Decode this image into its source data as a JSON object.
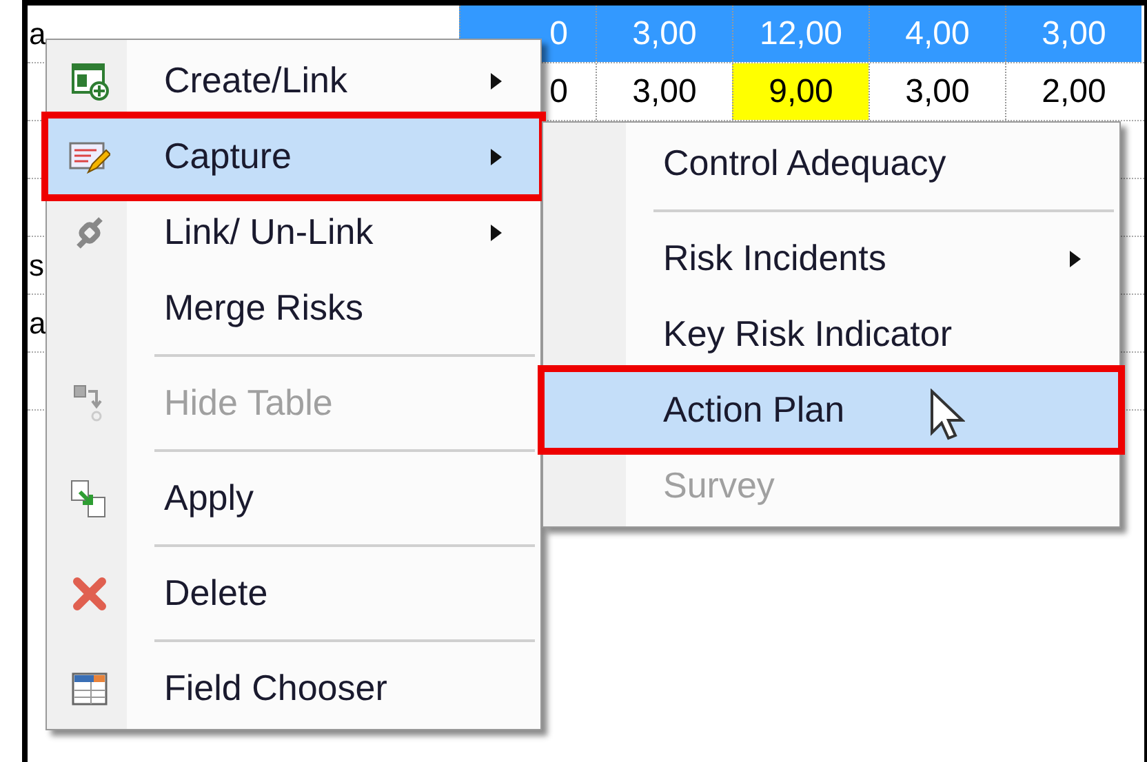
{
  "grid": {
    "rows": [
      {
        "label": "a",
        "cells": [
          {
            "text": "0",
            "kind": "header"
          },
          {
            "text": "3,00",
            "kind": "header"
          },
          {
            "text": "12,00",
            "kind": "header"
          },
          {
            "text": "4,00",
            "kind": "header"
          },
          {
            "text": "3,00",
            "kind": "header"
          }
        ]
      },
      {
        "label": "",
        "cells": [
          {
            "text": "0",
            "kind": "plain"
          },
          {
            "text": "3,00",
            "kind": "plain"
          },
          {
            "text": "9,00",
            "kind": "flag"
          },
          {
            "text": "3,00",
            "kind": "plain"
          },
          {
            "text": "2,00",
            "kind": "plain"
          }
        ]
      },
      {
        "label": "",
        "cells": []
      },
      {
        "label": "",
        "cells": []
      },
      {
        "label": "s",
        "cells": []
      },
      {
        "label": "a",
        "cells": []
      },
      {
        "label": "",
        "cells": []
      }
    ]
  },
  "context_menu": {
    "items": [
      {
        "kind": "item",
        "label": "Create/Link",
        "submenu": true,
        "disabled": false,
        "selected": false,
        "outlined": false
      },
      {
        "kind": "item",
        "label": "Capture",
        "submenu": true,
        "disabled": false,
        "selected": true,
        "outlined": true
      },
      {
        "kind": "item",
        "label": "Link/ Un-Link",
        "submenu": true,
        "disabled": false,
        "selected": false,
        "outlined": false
      },
      {
        "kind": "item",
        "label": "Merge Risks",
        "submenu": false,
        "disabled": false,
        "selected": false,
        "outlined": false
      },
      {
        "kind": "separator"
      },
      {
        "kind": "item",
        "label": "Hide Table",
        "submenu": false,
        "disabled": true,
        "selected": false,
        "outlined": false
      },
      {
        "kind": "separator"
      },
      {
        "kind": "item",
        "label": "Apply",
        "submenu": false,
        "disabled": false,
        "selected": false,
        "outlined": false
      },
      {
        "kind": "separator"
      },
      {
        "kind": "item",
        "label": "Delete",
        "submenu": false,
        "disabled": false,
        "selected": false,
        "outlined": false
      },
      {
        "kind": "separator"
      },
      {
        "kind": "item",
        "label": "Field Chooser",
        "submenu": false,
        "disabled": false,
        "selected": false,
        "outlined": false
      }
    ]
  },
  "submenu": {
    "items": [
      {
        "kind": "item",
        "label": "Control Adequacy",
        "submenu": false,
        "disabled": false,
        "selected": false,
        "outlined": false
      },
      {
        "kind": "separator"
      },
      {
        "kind": "item",
        "label": "Risk Incidents",
        "submenu": true,
        "disabled": false,
        "selected": false,
        "outlined": false
      },
      {
        "kind": "item",
        "label": "Key Risk Indicator",
        "submenu": false,
        "disabled": false,
        "selected": false,
        "outlined": false
      },
      {
        "kind": "item",
        "label": "Action Plan",
        "submenu": false,
        "disabled": false,
        "selected": true,
        "outlined": true
      },
      {
        "kind": "item",
        "label": "Survey",
        "submenu": false,
        "disabled": true,
        "selected": false,
        "outlined": false
      }
    ]
  }
}
